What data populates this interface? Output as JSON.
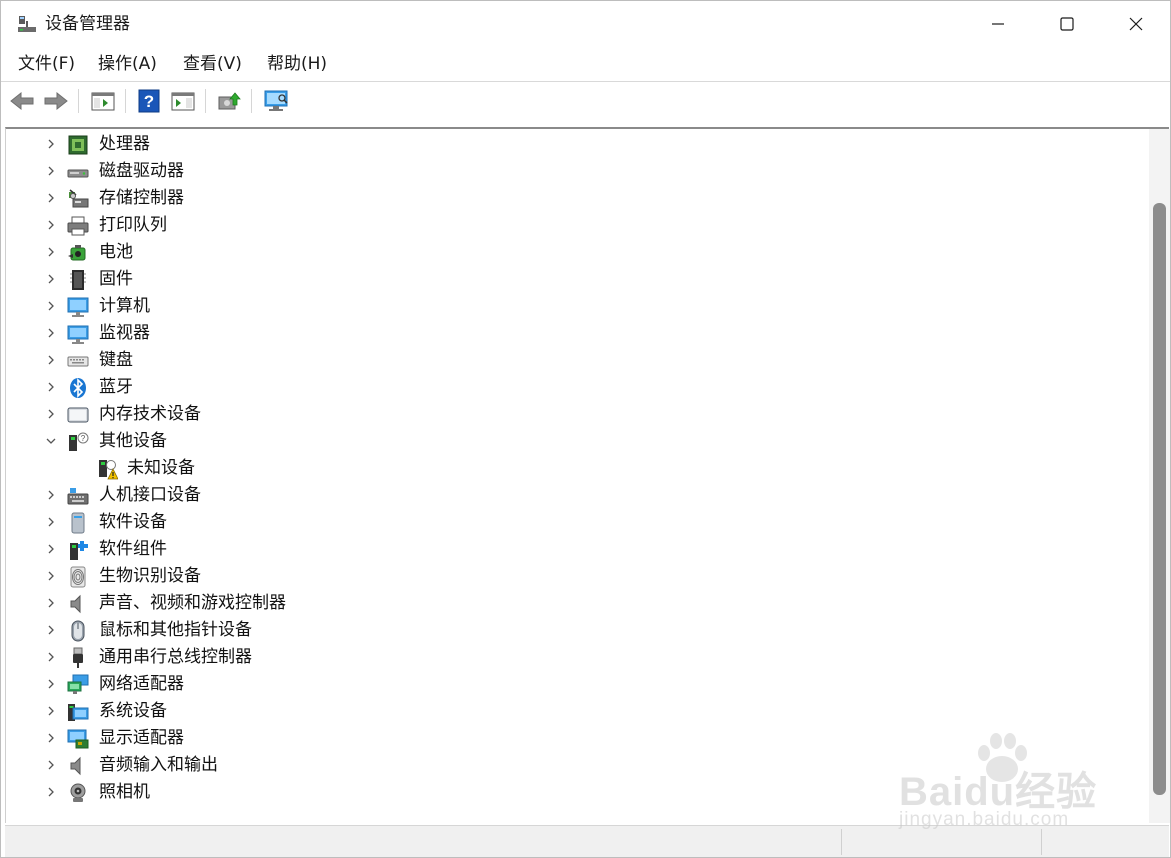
{
  "window": {
    "title": "设备管理器"
  },
  "menu": {
    "items": [
      "文件(F)",
      "操作(A)",
      "查看(V)",
      "帮助(H)"
    ]
  },
  "toolbar": {
    "buttons": [
      "back-icon",
      "forward-icon",
      "properties-pane-icon",
      "help-icon",
      "action-pane-icon",
      "update-driver-icon",
      "scan-hardware-icon"
    ]
  },
  "tree": {
    "items": [
      {
        "label": "处理器",
        "icon": "processor-icon",
        "expanded": false
      },
      {
        "label": "磁盘驱动器",
        "icon": "disk-drive-icon",
        "expanded": false
      },
      {
        "label": "存储控制器",
        "icon": "storage-controller-icon",
        "expanded": false
      },
      {
        "label": "打印队列",
        "icon": "printer-icon",
        "expanded": false
      },
      {
        "label": "电池",
        "icon": "battery-icon",
        "expanded": false
      },
      {
        "label": "固件",
        "icon": "firmware-icon",
        "expanded": false
      },
      {
        "label": "计算机",
        "icon": "computer-icon",
        "expanded": false
      },
      {
        "label": "监视器",
        "icon": "monitor-icon",
        "expanded": false
      },
      {
        "label": "键盘",
        "icon": "keyboard-icon",
        "expanded": false
      },
      {
        "label": "蓝牙",
        "icon": "bluetooth-icon",
        "expanded": false
      },
      {
        "label": "内存技术设备",
        "icon": "memory-device-icon",
        "expanded": false
      },
      {
        "label": "其他设备",
        "icon": "other-devices-icon",
        "expanded": true
      },
      {
        "label": "未知设备",
        "icon": "unknown-device-warning-icon",
        "child": true
      },
      {
        "label": "人机接口设备",
        "icon": "hid-icon",
        "expanded": false
      },
      {
        "label": "软件设备",
        "icon": "software-device-icon",
        "expanded": false
      },
      {
        "label": "软件组件",
        "icon": "software-component-icon",
        "expanded": false
      },
      {
        "label": "生物识别设备",
        "icon": "biometric-icon",
        "expanded": false
      },
      {
        "label": "声音、视频和游戏控制器",
        "icon": "sound-icon",
        "expanded": false
      },
      {
        "label": "鼠标和其他指针设备",
        "icon": "mouse-icon",
        "expanded": false
      },
      {
        "label": "通用串行总线控制器",
        "icon": "usb-icon",
        "expanded": false
      },
      {
        "label": "网络适配器",
        "icon": "network-adapter-icon",
        "expanded": false
      },
      {
        "label": "系统设备",
        "icon": "system-device-icon",
        "expanded": false
      },
      {
        "label": "显示适配器",
        "icon": "display-adapter-icon",
        "expanded": false
      },
      {
        "label": "音频输入和输出",
        "icon": "audio-io-icon",
        "expanded": false
      },
      {
        "label": "照相机",
        "icon": "camera-icon",
        "expanded": false
      }
    ]
  },
  "watermark": {
    "main": "Baidu经验",
    "sub": "jingyan.baidu.com"
  },
  "colors": {
    "accent": "#2b7bd6",
    "warning": "#f2c200",
    "scroll_thumb": "#8c8c8c"
  }
}
